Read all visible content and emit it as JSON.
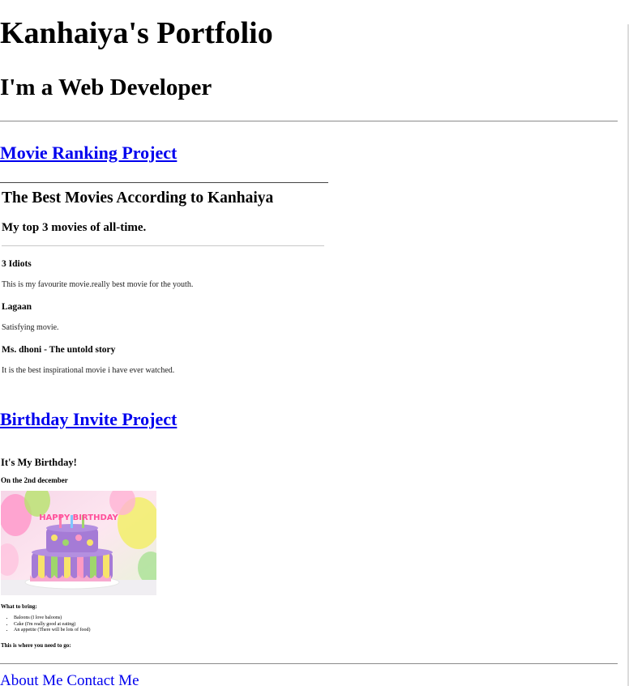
{
  "header": {
    "title": "Kanhaiya's Portfolio",
    "subtitle": "I'm a Web Developer"
  },
  "projects": {
    "movie_link": "Movie Ranking Project",
    "birthday_link": "Birthday Invite Project"
  },
  "movies": {
    "title": "The Best Movies According to Kanhaiya",
    "subtitle": "My top 3 movies of all-time.",
    "items": [
      {
        "name": "3 Idiots",
        "desc": "This is my favourite movie.really best movie for the youth."
      },
      {
        "name": "Lagaan",
        "desc": "Satisfying movie."
      },
      {
        "name": "Ms. dhoni - The untold story",
        "desc": "It is the best inspirational movie i have ever watched."
      }
    ]
  },
  "birthday": {
    "title": "It's My Birthday!",
    "date": "On the 2nd december",
    "cake_text": "HAPPY BIRTHDAY",
    "bring_label": "What to bring:",
    "items": [
      "Baloons (I love baloons)",
      "Cake (I'm really good at eating)",
      "An appetite (There will be lots of food)"
    ],
    "where_label": "This is where you need to go:"
  },
  "footer": {
    "about": "About Me",
    "contact": "Contact Me"
  }
}
